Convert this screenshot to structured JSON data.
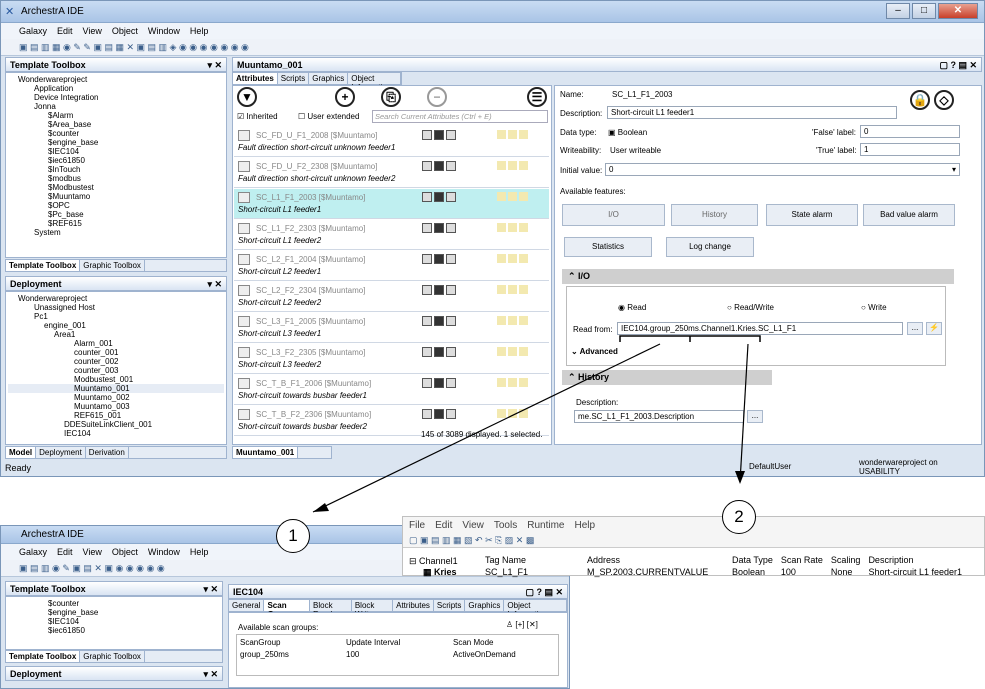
{
  "main": {
    "title": "ArchestrA IDE",
    "menu": [
      "Galaxy",
      "Edit",
      "View",
      "Object",
      "Window",
      "Help"
    ],
    "template_toolbox": {
      "title": "Template Toolbox",
      "tree": [
        "Wonderwareproject",
        "Application",
        "Device Integration",
        "Jonna",
        "$Alarm",
        "$Area_base",
        "$counter",
        "$engine_base",
        "$IEC104",
        "$iec61850",
        "$InTouch",
        "$modbus",
        "$Modbustest",
        "$Muuntamo",
        "$OPC",
        "$Pc_base",
        "$REF615",
        "System"
      ]
    },
    "toolbox_tabs": [
      "Template Toolbox",
      "Graphic Toolbox"
    ],
    "deployment": {
      "title": "Deployment",
      "tree": [
        "Wonderwareproject",
        "Unassigned Host",
        "Pc1",
        "engine_001",
        "Area1",
        "Alarm_001",
        "counter_001",
        "counter_002",
        "counter_003",
        "Modbustest_001",
        "Muuntamo_001",
        "Muuntamo_002",
        "Muuntamo_003",
        "REF615_001",
        "DDESuiteLinkClient_001",
        "IEC104"
      ]
    },
    "bottom_tabs": [
      "Model",
      "Deployment",
      "Derivation"
    ],
    "status": "Ready",
    "editor": {
      "title": "Muuntamo_001",
      "tabs": [
        "Attributes",
        "Scripts",
        "Graphics",
        "Object Information"
      ],
      "inherited": "Inherited",
      "user_extended": "User extended",
      "search_placeholder": "Search Current Attributes (Ctrl + E)",
      "rows": [
        {
          "name": "SC_FD_U_F1_2008 [$Muuntamo]",
          "desc": "Fault direction short-circuit unknown feeder1"
        },
        {
          "name": "SC_FD_U_F2_2308 [$Muuntamo]",
          "desc": "Fault direction short-circuit unknown feeder2"
        },
        {
          "name": "SC_L1_F1_2003 [$Muuntamo]",
          "desc": "Short-circuit L1 feeder1"
        },
        {
          "name": "SC_L1_F2_2303 [$Muuntamo]",
          "desc": "Short-circuit L1 feeder2"
        },
        {
          "name": "SC_L2_F1_2004 [$Muuntamo]",
          "desc": "Short-circuit L2 feeder1"
        },
        {
          "name": "SC_L2_F2_2304 [$Muuntamo]",
          "desc": "Short-circuit L2 feeder2"
        },
        {
          "name": "SC_L3_F1_2005 [$Muuntamo]",
          "desc": "Short-circuit L3 feeder1"
        },
        {
          "name": "SC_L3_F2_2305 [$Muuntamo]",
          "desc": "Short-circuit L3 feeder2"
        },
        {
          "name": "SC_T_B_F1_2006 [$Muuntamo]",
          "desc": "Short-circuit towards busbar feeder1"
        },
        {
          "name": "SC_T_B_F2_2306 [$Muuntamo]",
          "desc": "Short-circuit towards busbar feeder2"
        }
      ],
      "count": "145 of 3089 displayed. 1 selected.",
      "doc_tab": "Muuntamo_001",
      "props": {
        "name_label": "Name:",
        "name": "SC_L1_F1_2003",
        "desc_label": "Description:",
        "desc": "Short-circuit L1 feeder1",
        "type_label": "Data type:",
        "type": "Boolean",
        "false_label": "'False' label:",
        "false_val": "0",
        "write_label": "Writeability:",
        "write": "User writeable",
        "true_label": "'True' label:",
        "true_val": "1",
        "init_label": "Initial value:",
        "init": "0",
        "features_label": "Available features:",
        "io": "I/O",
        "history": "History",
        "state_alarm": "State alarm",
        "bad_value": "Bad value alarm",
        "statistics": "Statistics",
        "log_change": "Log change",
        "io_section": "I/O",
        "read": "Read",
        "read_write": "Read/Write",
        "write_opt": "Write",
        "read_from_label": "Read from:",
        "read_from": "IEC104.group_250ms.Channel1.Kries.SC_L1_F1",
        "advanced": "Advanced",
        "history_section": "History",
        "hist_desc_label": "Description:",
        "hist_desc": "me.SC_L1_F1_2003.Description"
      },
      "default_user": "DefaultUser",
      "project_status": "wonderwareproject on USABILITY"
    }
  },
  "win2": {
    "title": "ArchestrA IDE",
    "menu": [
      "Galaxy",
      "Edit",
      "View",
      "Object",
      "Window",
      "Help"
    ],
    "toolbox": "Template Toolbox",
    "tree": [
      "$counter",
      "$engine_base",
      "$IEC104",
      "$iec61850"
    ],
    "toolbox_tabs": [
      "Template Toolbox",
      "Graphic Toolbox"
    ],
    "deployment": "Deployment",
    "editor_title": "IEC104",
    "tabs": [
      "General",
      "Scan Group",
      "Block Read",
      "Block Write",
      "Attributes",
      "Scripts",
      "Graphics",
      "Object Information"
    ],
    "scan_label": "Available scan groups:",
    "cols": [
      "ScanGroup",
      "Update Interval",
      "Scan Mode"
    ],
    "row": [
      "group_250ms",
      "100",
      "ActiveOnDemand"
    ]
  },
  "win3": {
    "menu": [
      "File",
      "Edit",
      "View",
      "Tools",
      "Runtime",
      "Help"
    ],
    "tree": [
      "Channel1",
      "Kries"
    ],
    "cols": [
      "Tag Name",
      "Address",
      "Data Type",
      "Scan Rate",
      "Scaling",
      "Description"
    ],
    "row": [
      "SC_L1_F1",
      "M_SP.2003.CURRENTVALUE",
      "Boolean",
      "100",
      "None",
      "Short-circuit L1 feeder1"
    ]
  },
  "callouts": [
    "1",
    "2"
  ]
}
